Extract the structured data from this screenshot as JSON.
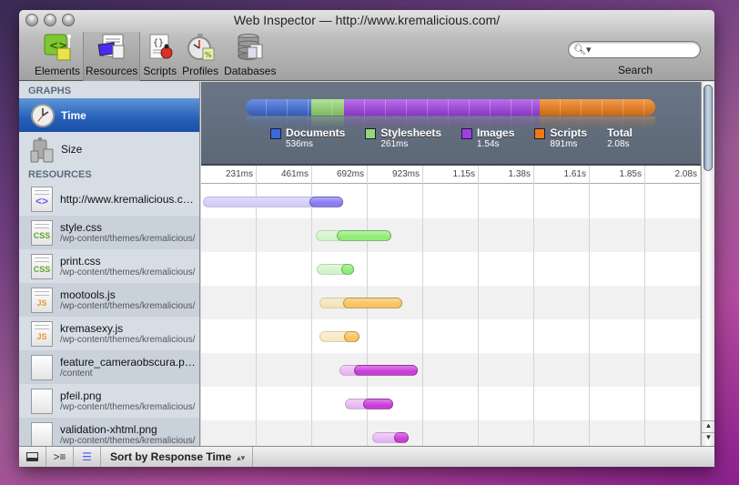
{
  "window": {
    "title": "Web Inspector — http://www.kremalicious.com/"
  },
  "toolbar": {
    "tools": [
      {
        "label": "Elements",
        "icon": "elements-icon"
      },
      {
        "label": "Resources",
        "icon": "resources-icon",
        "active": true
      },
      {
        "label": "Scripts",
        "icon": "scripts-icon"
      },
      {
        "label": "Profiles",
        "icon": "profiles-icon"
      },
      {
        "label": "Databases",
        "icon": "databases-icon"
      }
    ],
    "search": {
      "label": "Search",
      "value": "",
      "placeholder": ""
    }
  },
  "sidebar": {
    "graphs_heading": "GRAPHS",
    "graphs": [
      {
        "label": "Time",
        "selected": true
      },
      {
        "label": "Size",
        "selected": false
      }
    ],
    "resources_heading": "RESOURCES",
    "resources": [
      {
        "name": "http://www.kremalicious.com/",
        "path": "",
        "type": "document"
      },
      {
        "name": "style.css",
        "path": "/wp-content/themes/kremalicious/",
        "type": "css"
      },
      {
        "name": "print.css",
        "path": "/wp-content/themes/kremalicious/",
        "type": "css"
      },
      {
        "name": "mootools.js",
        "path": "/wp-content/themes/kremalicious/",
        "type": "js"
      },
      {
        "name": "kremasexy.js",
        "path": "/wp-content/themes/kremalicious/",
        "type": "js"
      },
      {
        "name": "feature_cameraobscura.png",
        "path": "/content",
        "type": "image"
      },
      {
        "name": "pfeil.png",
        "path": "/wp-content/themes/kremalicious/",
        "type": "image"
      },
      {
        "name": "validation-xhtml.png",
        "path": "/wp-content/themes/kremalicious/",
        "type": "image"
      }
    ]
  },
  "summary": {
    "categories": [
      {
        "label": "Documents",
        "value": "536ms",
        "color": "#3a6ad8",
        "fraction": 0.16
      },
      {
        "label": "Stylesheets",
        "value": "261ms",
        "color": "#95d975",
        "fraction": 0.08
      },
      {
        "label": "Images",
        "value": "1.54s",
        "color": "#a23ee6",
        "fraction": 0.478
      },
      {
        "label": "Scripts",
        "value": "891ms",
        "color": "#ef7a12",
        "fraction": 0.282
      }
    ],
    "total_label": "Total",
    "total_value": "2.08s"
  },
  "timeline": {
    "ticks": [
      "231ms",
      "461ms",
      "692ms",
      "923ms",
      "1.15s",
      "1.38s",
      "1.61s",
      "1.85s",
      "2.08s"
    ],
    "bars": [
      {
        "start": 0.004,
        "response": 0.217,
        "end": 0.284,
        "wait_color": "#cdc8f8",
        "recv_color": "#8a7df0"
      },
      {
        "start": 0.23,
        "response": 0.272,
        "end": 0.38,
        "wait_color": "#cdf3c4",
        "recv_color": "#92ec78"
      },
      {
        "start": 0.232,
        "response": 0.28,
        "end": 0.306,
        "wait_color": "#cdf3c4",
        "recv_color": "#92ec78"
      },
      {
        "start": 0.236,
        "response": 0.284,
        "end": 0.402,
        "wait_color": "#f5e0b0",
        "recv_color": "#f8c460"
      },
      {
        "start": 0.236,
        "response": 0.286,
        "end": 0.317,
        "wait_color": "#f9e6bb",
        "recv_color": "#f8c460"
      },
      {
        "start": 0.277,
        "response": 0.306,
        "end": 0.434,
        "wait_color": "#e5b0f0",
        "recv_color": "#c93ed8"
      },
      {
        "start": 0.288,
        "response": 0.324,
        "end": 0.384,
        "wait_color": "#e5b0f0",
        "recv_color": "#c93ed8"
      },
      {
        "start": 0.342,
        "response": 0.386,
        "end": 0.415,
        "wait_color": "#e5b0f0",
        "recv_color": "#c93ed8"
      }
    ]
  },
  "bottombar": {
    "sort_label": "Sort by Response Time"
  }
}
